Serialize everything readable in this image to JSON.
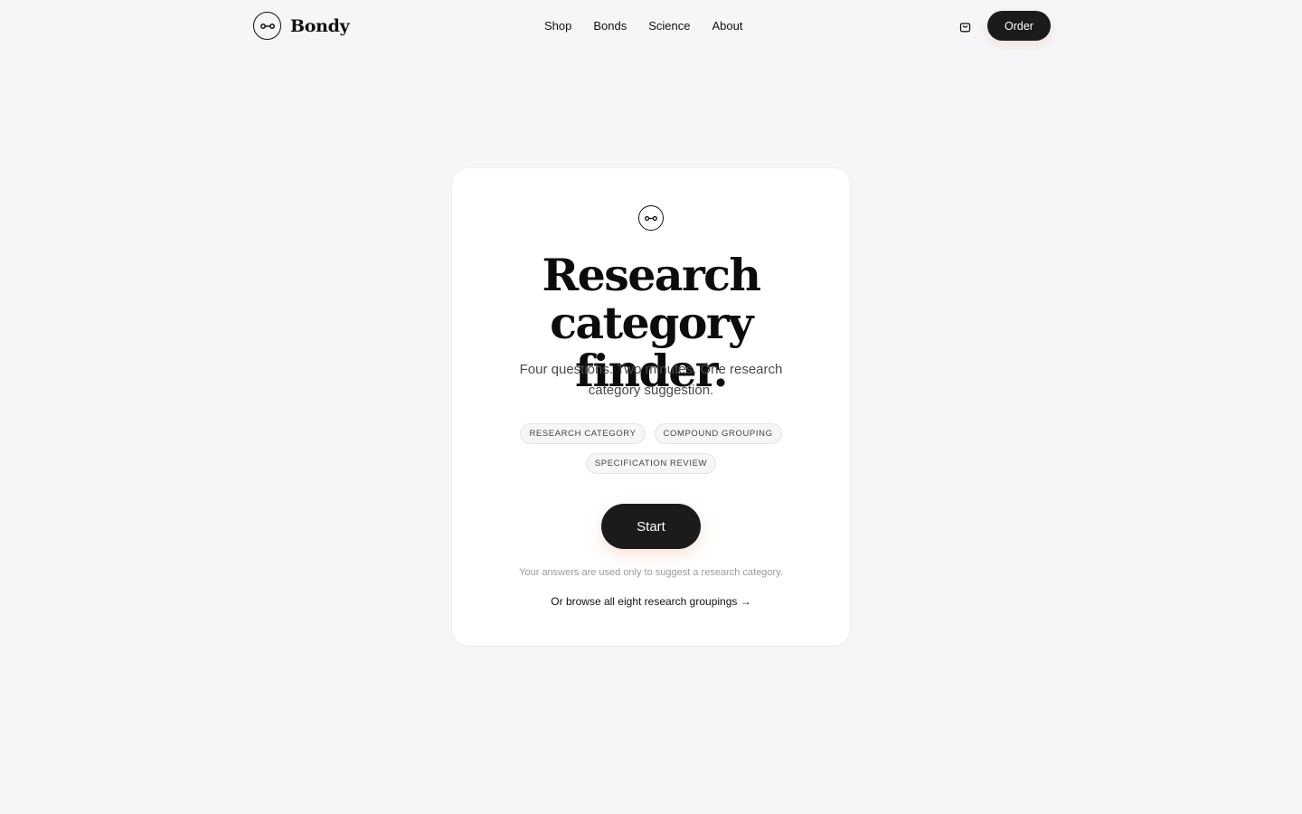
{
  "header": {
    "brand_name": "Bondy",
    "nav": [
      {
        "label": "Shop"
      },
      {
        "label": "Bonds"
      },
      {
        "label": "Science"
      },
      {
        "label": "About"
      }
    ],
    "order_label": "Order"
  },
  "card": {
    "title_line1": "Research",
    "title_line2": "category finder.",
    "subtitle": "Four questions. Two minutes. One research category suggestion.",
    "tags": [
      "Research category",
      "Compound grouping",
      "Specification review"
    ],
    "start_label": "Start",
    "note": "Your answers are used only to suggest a research category.",
    "browse_link": "Or browse all eight research groupings →"
  },
  "colors": {
    "background": "#f6f6f8",
    "card": "#ffffff",
    "button": "#1b1b1b",
    "button_text": "#ffffff",
    "muted_text": "#9a9a9e"
  },
  "icons": {
    "brand": "bond-link-icon",
    "cart": "shopping-bag-icon"
  }
}
